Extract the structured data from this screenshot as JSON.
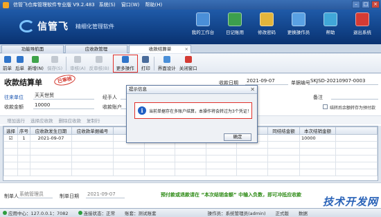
{
  "window": {
    "title": "信管飞仓库管理软件专业版 V9.2.483",
    "menu": [
      "系统(S)",
      "窗口(W)",
      "帮助(H)"
    ]
  },
  "header": {
    "brand": "信管飞",
    "slogan": "精细化管理软件",
    "buttons": [
      {
        "label": "我的工作台",
        "icon": "workbench-icon",
        "color": "#4a8fd8"
      },
      {
        "label": "日记账用",
        "icon": "journal-icon",
        "color": "#3c9f4d"
      },
      {
        "label": "修改密码",
        "icon": "key-icon",
        "color": "#e2b53c"
      },
      {
        "label": "更换操作员",
        "icon": "user-switch-icon",
        "color": "#5aa1e3"
      },
      {
        "label": "帮助",
        "icon": "help-icon",
        "color": "#41a7d8"
      },
      {
        "label": "退出系统",
        "icon": "power-icon",
        "color": "#d43b34"
      }
    ]
  },
  "module_tabs": [
    {
      "label": "功能导航面",
      "active": false
    },
    {
      "label": "应收款管理",
      "active": false
    },
    {
      "label": "收款结算单",
      "active": true,
      "close": "×"
    }
  ],
  "toolbar": [
    {
      "label": "前单",
      "icon": "arrow-up-icon",
      "color": "#2f74c9",
      "disabled": false
    },
    {
      "label": "后单",
      "icon": "arrow-down-icon",
      "color": "#2f74c9",
      "disabled": false
    },
    {
      "label": "新增(N)",
      "icon": "add-icon",
      "color": "#3ea34a",
      "disabled": false
    },
    {
      "label": "保存(S)",
      "icon": "save-icon",
      "color": "#9aa3ad",
      "disabled": true
    },
    {
      "label": "审核(A)",
      "icon": "audit-icon",
      "color": "#9aa3ad",
      "disabled": true
    },
    {
      "label": "反审核(B)",
      "icon": "unaudit-icon",
      "color": "#9aa3ad",
      "disabled": true
    },
    {
      "label": "更多操作",
      "icon": "more-actions-icon",
      "color": "#2f74c9",
      "disabled": false,
      "highlight": true
    },
    {
      "label": "打印",
      "icon": "print-icon",
      "color": "#4a6c9b",
      "disabled": false
    },
    {
      "label": "界面设计",
      "icon": "layout-design-icon",
      "color": "#4a8fd8",
      "disabled": false
    },
    {
      "label": "关闭窗口",
      "icon": "close-window-icon",
      "color": "#d43b34",
      "disabled": false
    }
  ],
  "form": {
    "title": "收款结算单",
    "stamp": "已审核",
    "date_label": "收款日期",
    "date_value": "2021-09-07",
    "docno_label": "单据编号",
    "docno_value": "SKJSD-20210907-0003",
    "customer_label": "往来单位",
    "customer_value": "天天世贸",
    "handler_label": "经手人",
    "remark_label": "备注",
    "total_label": "收款金额",
    "total_value": "10000",
    "account_label": "收款账户",
    "checkbox_label": "结转后余额转存为预付款",
    "sub_toolbar": [
      "增加选行",
      "选择应收款",
      "删除应收款",
      "复制行"
    ]
  },
  "grid": {
    "headers": [
      "选择",
      "序号",
      "应收款发生日期",
      "应收款单据编号",
      "",
      "",
      "",
      "",
      "",
      "同结结金额",
      "本次结销金额",
      ""
    ],
    "rows": [
      {
        "checked": "☑",
        "no": "1",
        "date": "2021-09-07",
        "docno": "",
        "amount": "10000"
      }
    ]
  },
  "bottom": {
    "maker_label": "制单人",
    "maker_value": "系统管理员",
    "make_date_label": "制单日期",
    "make_date_value": "2021-09-07",
    "notice": "预付款或退款请在 “本次结销金额” 中输入负数，即可冲抵应收款"
  },
  "status": {
    "app_center": "应用中心：127.0.0.1：7082",
    "connect": "连接状态：正常",
    "account": "账套：测试账套",
    "operator": "操作员：系统管理员(admin)",
    "edition": "正式版",
    "data": "数据"
  },
  "dialog": {
    "title": "提示信息",
    "close": "✕",
    "info_glyph": "i",
    "message": "当前单据存在多账户结算，本操作将会转过为3个凭证！",
    "ok": "确定"
  },
  "watermark": "技术开发网"
}
